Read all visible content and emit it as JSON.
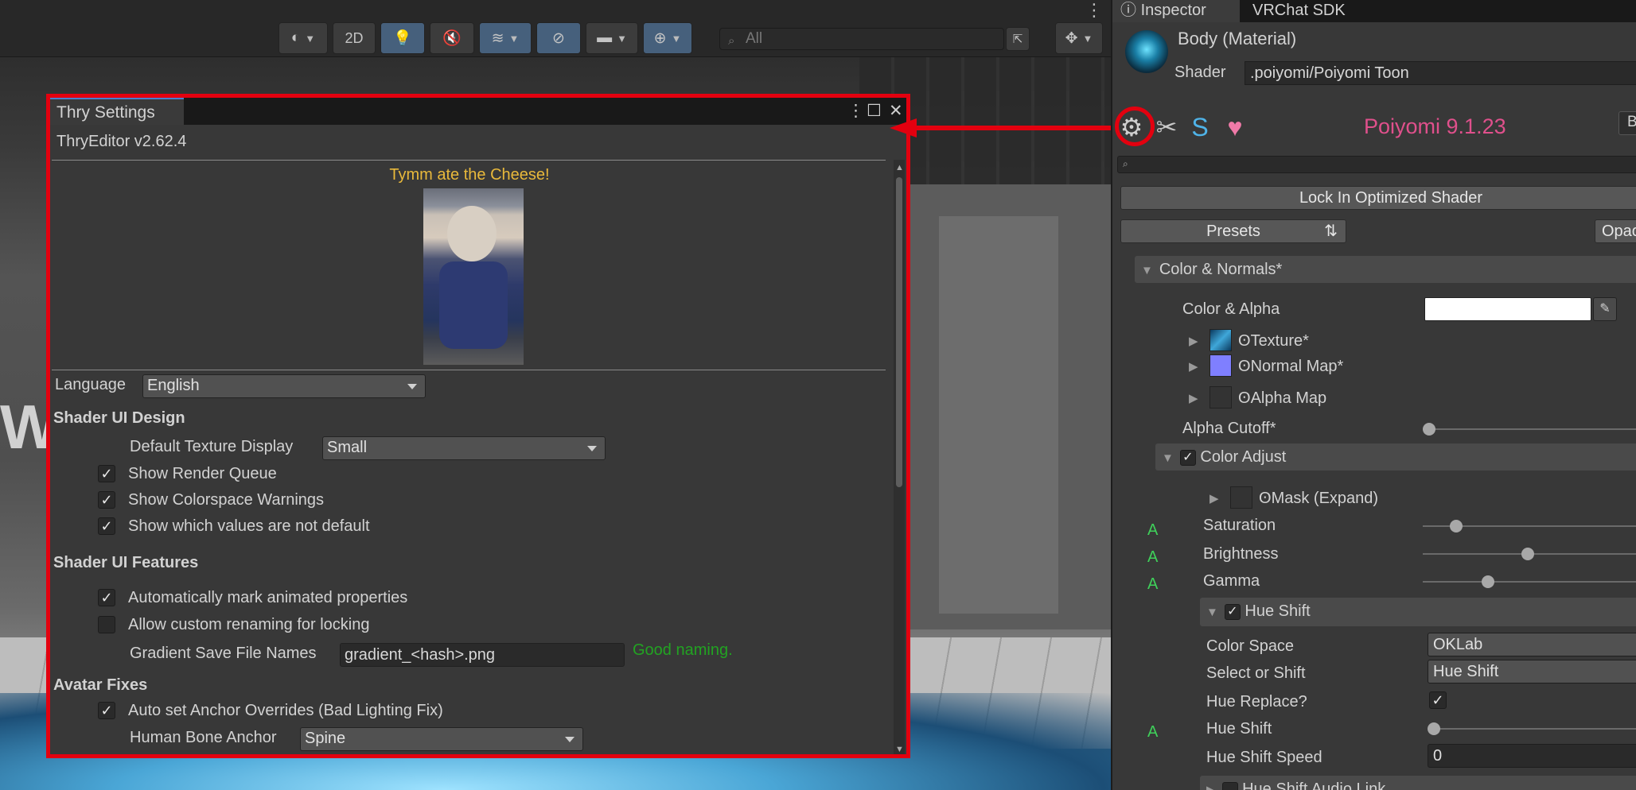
{
  "scene_toolbar": {
    "mode_2d": "2D",
    "search_placeholder": "All"
  },
  "scene_view": {
    "wall_letter": "W"
  },
  "thry": {
    "tab_title": "Thry Settings",
    "version": "ThryEditor v2.62.4",
    "cheese_title": "Tymm ate the Cheese!",
    "language_label": "Language",
    "language_value": "English",
    "sec_design": "Shader UI Design",
    "default_texture_label": "Default Texture Display",
    "default_texture_value": "Small",
    "show_render_queue": "Show Render Queue",
    "show_colorspace": "Show Colorspace Warnings",
    "show_values": "Show which values are not default",
    "sec_features": "Shader UI Features",
    "auto_mark": "Automatically mark animated properties",
    "allow_rename": "Allow custom renaming for locking",
    "gradient_label": "Gradient Save File Names",
    "gradient_value": "gradient_<hash>.png",
    "good_naming": "Good naming.",
    "sec_avatar": "Avatar Fixes",
    "auto_anchor": "Auto set Anchor Overrides (Bad Lighting Fix)",
    "bone_anchor_label": "Human Bone Anchor",
    "bone_anchor_value": "Spine"
  },
  "inspector": {
    "tab_inspector": "Inspector",
    "tab_vrchat": "VRChat SDK",
    "material_name": "Body (Material)",
    "shader_label": "Shader",
    "shader_value": ".poiyomi/Poiyomi Toon",
    "poiyomi_version": "Poiyomi 9.1.23",
    "right_btn": "B",
    "lock_in": "Lock In Optimized Shader",
    "presets": "Presets",
    "opac": "Opac",
    "color_normals": "Color & Normals*",
    "color_alpha": "Color & Alpha",
    "texture": "Texture*",
    "normal_map": "Normal Map*",
    "alpha_map": "Alpha Map",
    "alpha_cutoff": "Alpha Cutoff*",
    "color_adjust": "Color Adjust",
    "mask": "Mask (Expand)",
    "saturation": "Saturation",
    "brightness": "Brightness",
    "gamma": "Gamma",
    "hue_shift_group": "Hue Shift",
    "color_space_label": "Color Space",
    "color_space_value": "OKLab",
    "select_shift_label": "Select or Shift",
    "select_shift_value": "Hue Shift",
    "hue_replace": "Hue Replace?",
    "hue_shift": "Hue Shift",
    "hue_shift_speed": "Hue Shift Speed",
    "hue_shift_speed_value": "0",
    "hue_audio": "Hue Shift Audio Link",
    "anim_marker": "A"
  }
}
